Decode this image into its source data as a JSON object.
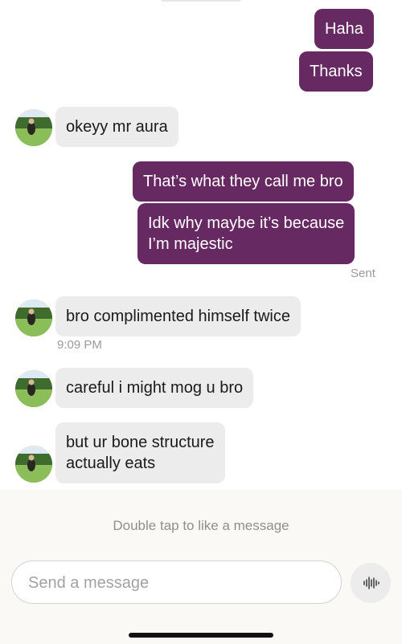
{
  "messages": {
    "m1": "Haha",
    "m2": "Thanks",
    "m3": "okeyy mr aura",
    "m4": "That’s what they call me bro",
    "m5_line1": "Idk why maybe it’s because",
    "m5_line2": "I’m majestic",
    "m6": "bro complimented himself twice",
    "m7": "careful i might mog u bro",
    "m8_line1": "but ur bone structure",
    "m8_line2": "actually eats"
  },
  "status": {
    "sent": "Sent",
    "time": "9:09 PM"
  },
  "footer": {
    "hint": "Double tap to like a message",
    "placeholder": "Send a message"
  },
  "colors": {
    "outgoing_bubble": "#672961",
    "incoming_bubble": "#ececec"
  },
  "icons": {
    "voice": "voice-waveform-icon",
    "avatar": "contact-avatar"
  }
}
